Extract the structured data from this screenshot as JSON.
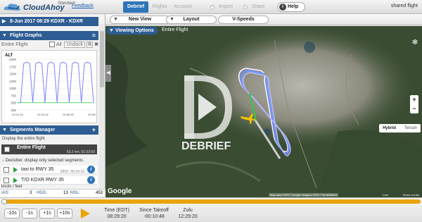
{
  "app": {
    "logo_text": "CloudAhoy",
    "logo_tier": "Standard",
    "feedback": "Feedback",
    "tabs": [
      "Debrief",
      "Flights",
      "Account",
      "Import",
      "Share"
    ],
    "help": "Help",
    "shared_label": "shared flight"
  },
  "toolbar2": {
    "new_view": "New View",
    "layout": "Layout",
    "vspeeds": "V-Speeds"
  },
  "flight": {
    "header": "8-Jun 2017 08:29   KDXR - KDXR"
  },
  "graphs": {
    "header": "Flight Graphs",
    "entire": "Entire Flight",
    "all": "All",
    "undock": "Undock",
    "param": "ALT",
    "y_ticks": [
      "2000",
      "1750",
      "1500",
      "1250",
      "1000",
      "750",
      "500",
      "250"
    ],
    "x_ticks": [
      "00:10:16",
      "00:32:52",
      "00:56:52",
      "00:59:32"
    ]
  },
  "segments": {
    "header": "Segments Manager",
    "display_entire": "Display the entire flight",
    "entire_btn": "Entire Flight",
    "entire_meta": "53.2 nm, 01:23:50",
    "declutter": "Declutter: display only selected segments",
    "rows": [
      {
        "label": "taxi to RWY 35",
        "meta": "3993', 00:10:16"
      },
      {
        "label": "T/O KDXR RWY 35",
        "meta": ""
      }
    ]
  },
  "units": "knots / feet",
  "status": {
    "ias_label": "IAS:",
    "ias": "3",
    "hdg_label": "HDG:",
    "hdg": "13",
    "msl_label": "MSL:",
    "msl": "453"
  },
  "map": {
    "viewing_options": "Viewing Options",
    "entire_flight": "Entire Flight",
    "brand": "DEBRIEF",
    "google": "Google",
    "hybrid": "Hybrid",
    "terrain": "Terrain",
    "attribution": "Map data ©2017 Google Imagery ©2017 TerraMetrics",
    "scale": "1 km",
    "terms": "Terms of Use"
  },
  "playback": {
    "steps": [
      "-10s",
      "-1s",
      "+1s",
      "+10s"
    ],
    "time_label": "Time (EDT)",
    "time_value": "08:29:20",
    "since_label": "Since Takeoff",
    "since_value": "-00:10:48",
    "zulu_label": "Zulu",
    "zulu_value": "12:29:20"
  },
  "colors": {
    "header_blue": "#2e5d93",
    "accent_orange": "#e9a400",
    "active_tab": "#2e74b8"
  },
  "chart_data": {
    "type": "line",
    "title": "ALT",
    "ylim": [
      250,
      2000
    ],
    "x": [
      0,
      2,
      4,
      6,
      8,
      10,
      12,
      14,
      16,
      18,
      20,
      22,
      24,
      26,
      28,
      30,
      32,
      34,
      36,
      38,
      40,
      42,
      44,
      46,
      48,
      50
    ],
    "series": [
      {
        "values": [
          500,
          500,
          1850,
          1900,
          1850,
          500,
          1850,
          1900,
          1850,
          500,
          1850,
          1900,
          1850,
          500,
          1850,
          1900,
          1850,
          500,
          1850,
          1900,
          1850,
          500,
          1850,
          1900,
          1850,
          500
        ]
      }
    ]
  }
}
